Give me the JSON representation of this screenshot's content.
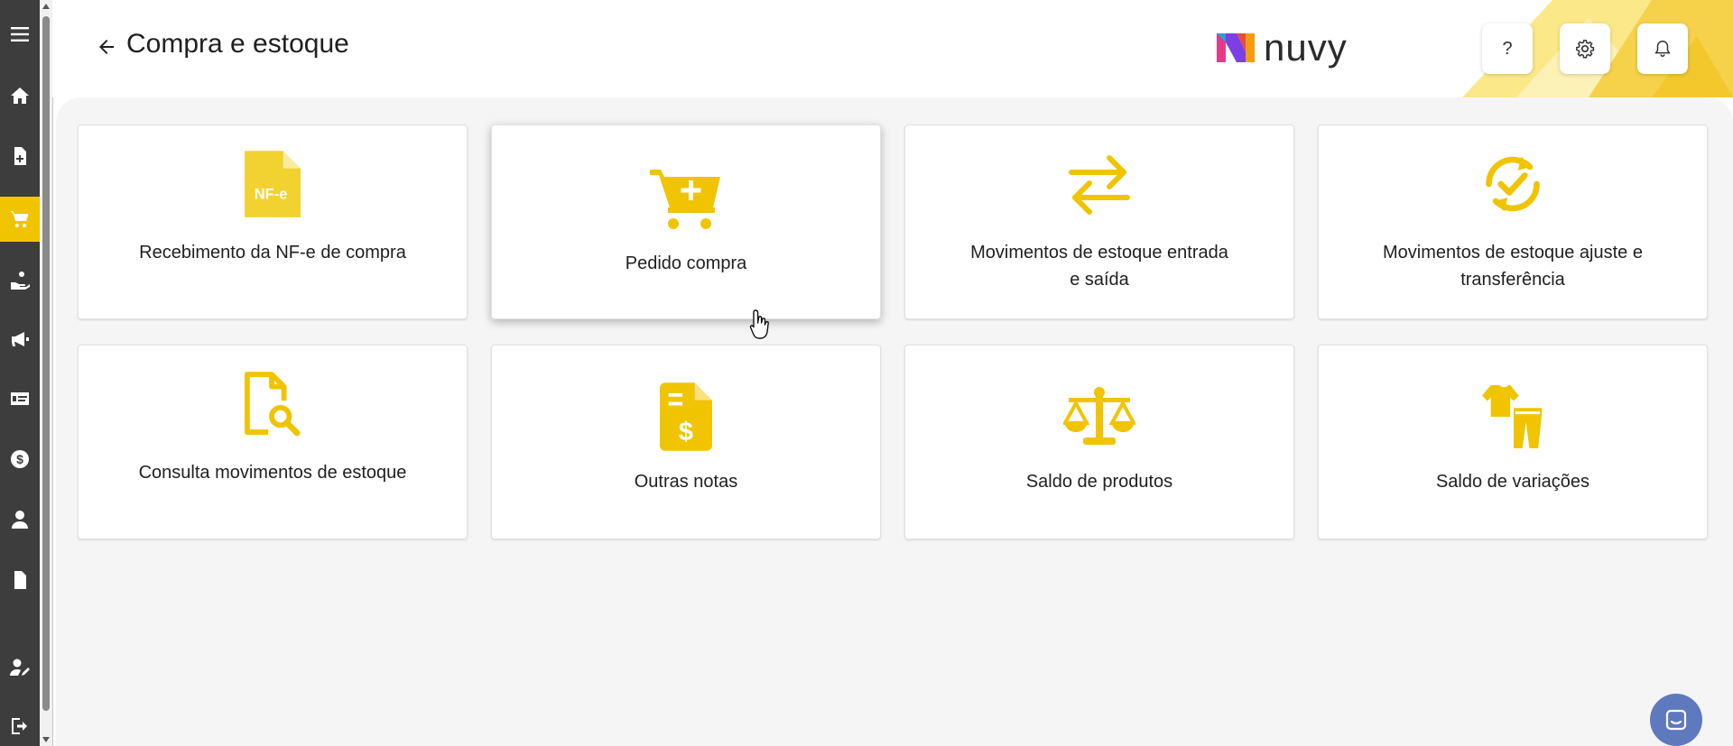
{
  "header": {
    "title": "Compra e estoque",
    "logo_text": "nuvy",
    "help_label": "?"
  },
  "sidebar": {
    "items": [
      {
        "icon": "menu-icon",
        "active": false
      },
      {
        "icon": "home-icon",
        "active": false
      },
      {
        "icon": "document-add-icon",
        "active": false
      },
      {
        "icon": "cart-icon",
        "active": true
      },
      {
        "icon": "hand-coins-icon",
        "active": false
      },
      {
        "icon": "megaphone-icon",
        "active": false
      },
      {
        "icon": "cash-card-icon",
        "active": false
      },
      {
        "icon": "dollar-coin-icon",
        "active": false
      },
      {
        "icon": "user-icon",
        "active": false
      },
      {
        "icon": "file-icon",
        "active": false
      },
      {
        "icon": "user-edit-icon",
        "active": false
      },
      {
        "icon": "logout-icon",
        "active": false
      }
    ]
  },
  "cards": [
    {
      "label": "Recebimento da NF-e de compra",
      "icon": "nfe-file-icon",
      "icon_text": "NF-e"
    },
    {
      "label": "Pedido compra",
      "icon": "cart-plus-icon"
    },
    {
      "label": "Movimentos de estoque entrada e saída",
      "icon": "swap-arrows-icon"
    },
    {
      "label": "Movimentos de estoque ajuste e transferência",
      "icon": "sync-check-icon"
    },
    {
      "label": "Consulta movimentos de estoque",
      "icon": "file-search-icon"
    },
    {
      "label": "Outras notas",
      "icon": "invoice-dollar-icon"
    },
    {
      "label": "Saldo de produtos",
      "icon": "scale-icon"
    },
    {
      "label": "Saldo de variações",
      "icon": "clothes-icon"
    }
  ],
  "colors": {
    "accent": "#f0c400",
    "sidebar_bg": "#3d3d3d",
    "chat_button": "#5f79bf"
  }
}
